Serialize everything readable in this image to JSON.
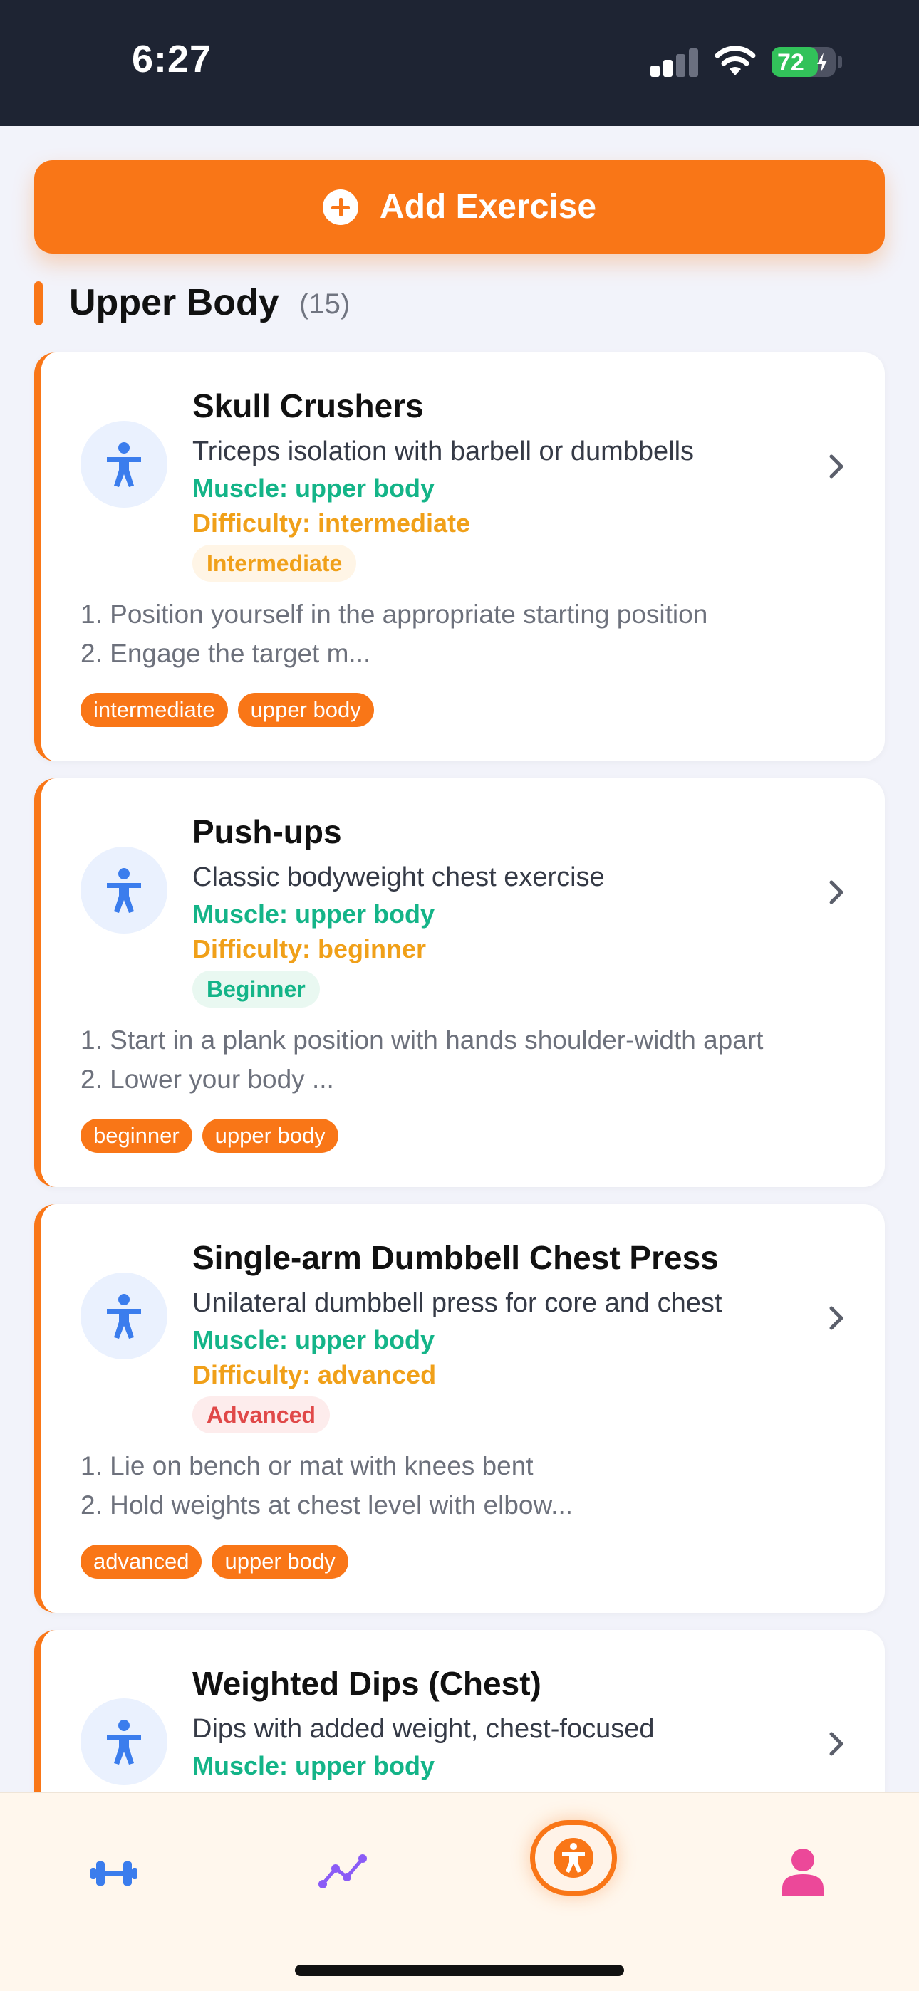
{
  "status_bar": {
    "time": "6:27",
    "battery_percent": "72",
    "battery_level": 0.72,
    "signal_bars_active": 2,
    "signal_bars_total": 4
  },
  "actions": {
    "add_exercise_label": "Add Exercise"
  },
  "section": {
    "title": "Upper Body",
    "count": "(15)"
  },
  "exercises": [
    {
      "title": "Skull Crushers",
      "description": "Triceps isolation with barbell or dumbbells",
      "muscle": "Muscle: upper body",
      "difficulty": "Difficulty: intermediate",
      "badge": "Intermediate",
      "badge_color": "#f0a019",
      "badge_bg": "#fff5e6",
      "steps": [
        "1. Position yourself in the appropriate starting position",
        "2. Engage the target m..."
      ],
      "tags": [
        "intermediate",
        "upper body"
      ]
    },
    {
      "title": "Push-ups",
      "description": "Classic bodyweight chest exercise",
      "muscle": "Muscle: upper body",
      "difficulty": "Difficulty: beginner",
      "badge": "Beginner",
      "badge_color": "#14b488",
      "badge_bg": "#e9f8f1",
      "steps": [
        "1. Start in a plank position with hands shoulder-width apart",
        "2. Lower your body ..."
      ],
      "tags": [
        "beginner",
        "upper body"
      ]
    },
    {
      "title": "Single-arm Dumbbell Chest Press",
      "description": "Unilateral dumbbell press for core and chest",
      "muscle": "Muscle: upper body",
      "difficulty": "Difficulty: advanced",
      "badge": "Advanced",
      "badge_color": "#e04848",
      "badge_bg": "#fdecec",
      "steps": [
        "1. Lie on bench or mat with knees bent",
        "2. Hold weights at chest level with elbow..."
      ],
      "tags": [
        "advanced",
        "upper body"
      ]
    },
    {
      "title": "Weighted Dips (Chest)",
      "description": "Dips with added weight, chest-focused",
      "muscle": "Muscle: upper body",
      "difficulty": "",
      "badge": "",
      "badge_color": "#f0a019",
      "badge_bg": "#fff5e6",
      "steps": [],
      "tags": []
    }
  ],
  "nav": {
    "items": [
      {
        "icon": "dumbbell-icon",
        "color": "#3b7ded"
      },
      {
        "icon": "trend-chart-icon",
        "color": "#8b5cf6"
      },
      {
        "icon": "accessibility-person-icon",
        "color": "#f97617",
        "active": true
      },
      {
        "icon": "profile-icon",
        "color": "#ec4899"
      }
    ]
  },
  "colors": {
    "accent": "#f97617",
    "muscle_text": "#14b488",
    "difficulty_text": "#f0a019",
    "exercise_icon": "#3b7ded"
  }
}
